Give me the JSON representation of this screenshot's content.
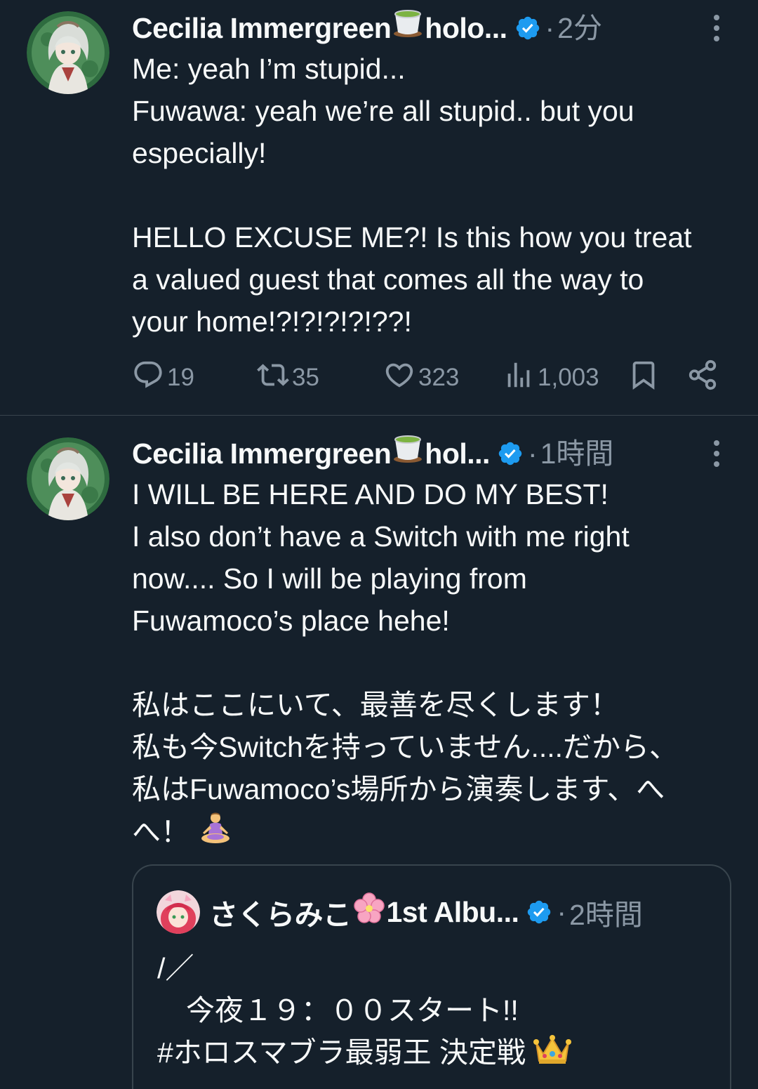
{
  "tweets": [
    {
      "author": "Cecilia Immergreen",
      "handle_suffix": "holo...",
      "separator": "·",
      "time": "2分",
      "lines": [
        "Me: yeah I’m stupid...",
        "Fuwawa: yeah we’re all stupid.. but you",
        "especially!",
        "",
        "HELLO EXCUSE ME?! Is this how you treat",
        "a valued guest that comes all the way to",
        "your home!?!?!?!?!??!"
      ],
      "actions": {
        "replies": "19",
        "reposts": "35",
        "likes": "323",
        "views": "1,003"
      }
    },
    {
      "author": "Cecilia Immergreen",
      "handle_suffix": "hol...",
      "separator": "·",
      "time": "1時間",
      "lines": [
        "I WILL BE HERE AND DO MY BEST!",
        "I also don’t have a Switch with me right",
        "now.... So I will be playing from",
        "Fuwamoco’s place hehe!",
        "",
        "私はここにいて、最善を尽くします！",
        "私も今Switchを持っていません....だから、",
        "私はFuwamoco’s場所から演奏します、へ",
        "へ！"
      ],
      "quote": {
        "author": "さくらみこ",
        "handle_suffix": "1st Albu...",
        "separator": "·",
        "time": "2時間",
        "lines": [
          "/／",
          "　今夜１９：００スタート!!",
          "#ホロスマブラ最弱王 決定戦"
        ]
      }
    }
  ],
  "icons": {
    "verified": "verified-badge-icon",
    "more": "more-options-icon",
    "reply": "reply-icon",
    "repost": "repost-icon",
    "like": "heart-icon",
    "views": "views-icon",
    "bookmark": "bookmark-icon",
    "share": "share-icon",
    "tea": "matcha-tea-emoji",
    "blossom": "cherry-blossom-emoji",
    "meditate": "person-in-lotus-position-emoji",
    "crown": "crown-emoji"
  },
  "colors": {
    "background": "#15202b",
    "text": "#f7f9f9",
    "muted": "#8b98a5",
    "verified": "#1d9bf0",
    "border": "#38444d"
  }
}
